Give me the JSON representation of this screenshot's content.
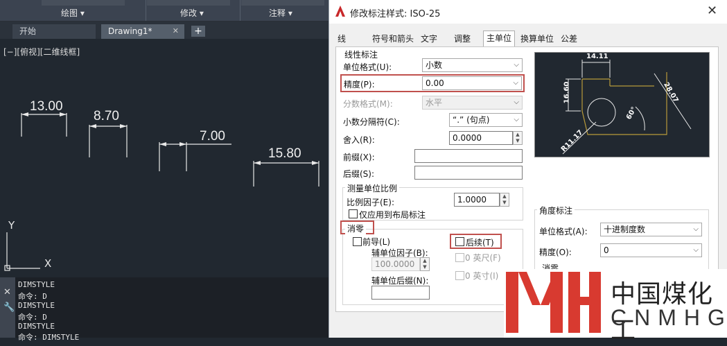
{
  "ribbon": {
    "draw": "绘图",
    "modify": "修改",
    "annotate": "注释"
  },
  "tabs": {
    "start": "开始",
    "drawing": "Drawing1*",
    "close": "✕",
    "add": "+"
  },
  "viewport": {
    "label": "[−][俯视][二维线框]"
  },
  "canvas": {
    "dims": [
      "13.00",
      "8.70",
      "7.00",
      "15.80"
    ],
    "ucs_y": "Y",
    "ucs_x": "X"
  },
  "command": {
    "lines": [
      "DIMSTYLE",
      "命令: D",
      "DIMSTYLE",
      "命令: D",
      "DIMSTYLE",
      "命令:  DIMSTYLE"
    ]
  },
  "dialog": {
    "title": "修改标注样式: ISO-25",
    "close": "✕",
    "tabs": [
      "线",
      "符号和箭头",
      "文字",
      "调整",
      "主单位",
      "换算单位",
      "公差"
    ],
    "linear": {
      "group": "线性标注",
      "unit_format_label": "单位格式(U):",
      "unit_format": "小数",
      "precision_label": "精度(P):",
      "precision": "0.00",
      "fraction_label": "分数格式(M):",
      "fraction": "水平",
      "decimal_sep_label": "小数分隔符(C):",
      "decimal_sep": "“.” (句点)",
      "round_label": "舍入(R):",
      "round": "0.0000",
      "prefix_label": "前缀(X):",
      "suffix_label": "后缀(S):"
    },
    "scale": {
      "group": "测量单位比例",
      "factor_label": "比例因子(E):",
      "factor": "1.0000",
      "layout_only": "仅应用到布局标注"
    },
    "zero": {
      "group": "消零",
      "leading": "前导(L)",
      "trailing": "后续(T)",
      "sub_factor_label": "辅单位因子(B):",
      "sub_factor": "100.0000",
      "sub_suffix_label": "辅单位后缀(N):",
      "feet": "0 英尺(F)",
      "inches": "0 英寸(I)"
    },
    "preview": {
      "d1": "14.11",
      "d2": "16.60",
      "d3": "28.07",
      "ang": "60°",
      "rad": "R11.17"
    },
    "angular": {
      "group": "角度标注",
      "unit_format_label": "单位格式(A):",
      "unit_format": "十进制度数",
      "precision_label": "精度(O):",
      "precision": "0",
      "zero_group": "消零"
    }
  },
  "watermark": {
    "cn": "中国煤化工",
    "en": "CNMHG"
  },
  "colors": {
    "accent_red": "#c0504d",
    "canvas_bg": "#212830",
    "preview_yellow": "#b89a3a"
  }
}
